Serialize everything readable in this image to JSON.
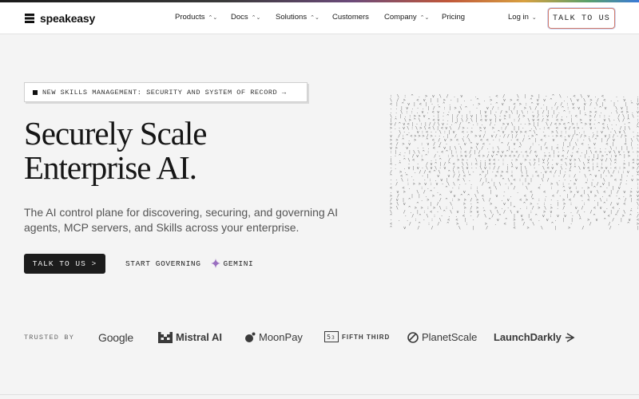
{
  "brand": {
    "name": "speakeasy"
  },
  "nav": {
    "items": [
      {
        "label": "Products",
        "dropdown": true
      },
      {
        "label": "Docs",
        "dropdown": true
      },
      {
        "label": "Solutions",
        "dropdown": true
      },
      {
        "label": "Customers",
        "dropdown": false
      },
      {
        "label": "Company",
        "dropdown": true
      },
      {
        "label": "Pricing",
        "dropdown": false
      }
    ],
    "login": "Log in",
    "cta": "TALK TO US"
  },
  "hero": {
    "announcement": "NEW SKILLS MANAGEMENT: SECURITY AND SYSTEM OF RECORD →",
    "title_line1": "Securely Scale",
    "title_line2": "Enterprise AI.",
    "subtitle": "The AI control plane for discovering, securing, and governing AI agents, MCP servers, and Skills across your enterprise.",
    "primary_cta": "TALK TO US >",
    "secondary_cta": "START GOVERNING",
    "gemini_label": "GEMINI"
  },
  "trusted": {
    "label": "TRUSTED BY",
    "logos": [
      "Google",
      "Mistral AI",
      "MoonPay",
      "FIFTH THIRD",
      "PlanetScale",
      "LaunchDarkly"
    ]
  },
  "colors": {
    "background": "#f4f4f4",
    "primary_button": "#1c1c1c",
    "cta_border": "#d07a6a",
    "gemini": "#9a6fc0"
  }
}
